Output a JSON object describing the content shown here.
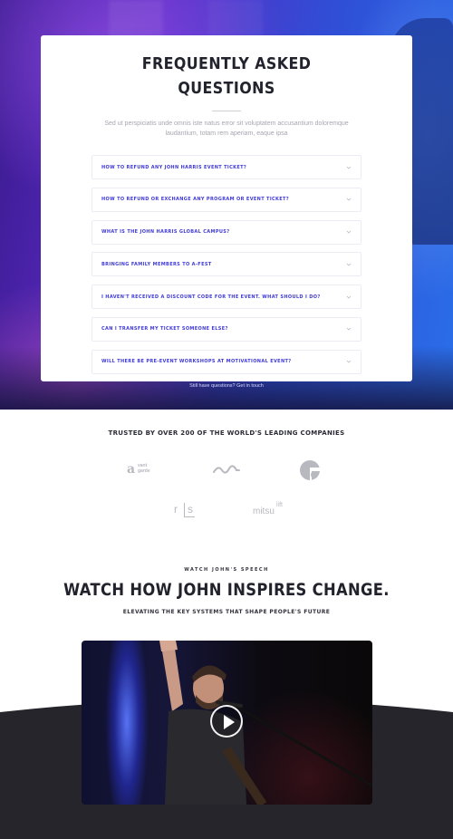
{
  "faq": {
    "title_line1": "FREQUENTLY ASKED",
    "title_line2": "QUESTIONS",
    "subtitle": "Sed ut perspiciatis unde omnis iste natus error sit voluptatem accusantium doloremque laudantium, totam rem aperiam, eaque ipsa",
    "items": [
      {
        "question": "How to refund any John Harris event ticket?"
      },
      {
        "question": "How to refund or exchange any program or event ticket?"
      },
      {
        "question": "What is the John Harris Global Campus?"
      },
      {
        "question": "Bringing family members to A-Fest"
      },
      {
        "question": "I haven't received a discount code for the event. What should I do?"
      },
      {
        "question": "Can I transfer my ticket someone else?"
      },
      {
        "question": "Will there be pre-event workshops at motivational event?"
      }
    ],
    "still_have_text": "Still have questions?",
    "get_in_touch": "Get in touch"
  },
  "trusted": {
    "title": "Trusted by over 200 of the world's leading companies",
    "logos": [
      {
        "name": "avant-garde-logo",
        "text_a": "a",
        "text_small_1": "vant",
        "text_small_2": "garde"
      },
      {
        "name": "wave-logo"
      },
      {
        "name": "e-logo"
      },
      {
        "name": "rs-logo",
        "text_r": "r",
        "text_s": "s"
      },
      {
        "name": "mitsulift-logo",
        "text_1": "mitsu",
        "text_2": "lift"
      }
    ]
  },
  "watch": {
    "kicker": "Watch John's Speech",
    "title": "Watch how John inspires change.",
    "subtitle": "Elevating the key systems that shape people's future"
  },
  "colors": {
    "accent": "#3f3ad8",
    "dark_bottom": "#25252b",
    "hero_purple": "#5a2bc4",
    "hero_blue": "#2a6ee8"
  }
}
